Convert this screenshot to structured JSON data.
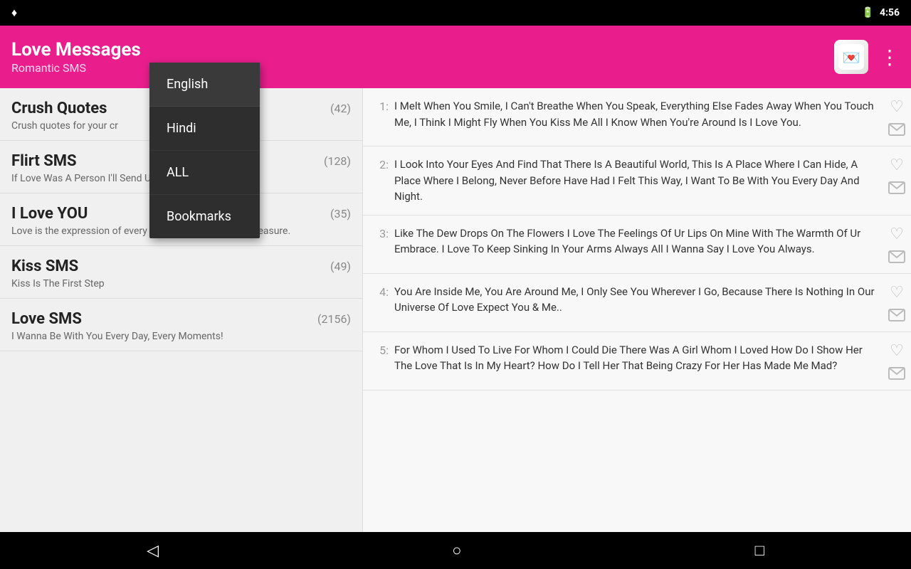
{
  "statusBar": {
    "leftIcon": "♦",
    "time": "4:56",
    "batteryIcon": "🔋"
  },
  "appBar": {
    "title": "Love Messages",
    "subtitle": "Romantic SMS",
    "moreIcon": "⋮"
  },
  "dropdown": {
    "items": [
      {
        "label": "English",
        "id": "english"
      },
      {
        "label": "Hindi",
        "id": "hindi"
      },
      {
        "label": "ALL",
        "id": "all"
      },
      {
        "label": "Bookmarks",
        "id": "bookmarks"
      }
    ]
  },
  "categories": [
    {
      "name": "Crush Quotes",
      "count": "(42)",
      "desc": "Crush quotes for your cr"
    },
    {
      "name": "Flirt SMS",
      "count": "(128)",
      "desc": "If Love Was A Person I'll Send U \"Me\""
    },
    {
      "name": "I Love YOU",
      "count": "(35)",
      "desc": "Love is the expression of every emotion that once can treasure."
    },
    {
      "name": "Kiss SMS",
      "count": "(49)",
      "desc": "Kiss Is The First Step"
    },
    {
      "name": "Love SMS",
      "count": "(2156)",
      "desc": "I Wanna Be With You Every Day, Every Moments!"
    }
  ],
  "messages": [
    {
      "number": "1:",
      "text": " I Melt When You Smile, I Can't Breathe When You Speak, Everything Else Fades Away When You Touch Me, I Think I Might Fly When You Kiss Me All I Know When You're Around Is I Love You."
    },
    {
      "number": "2:",
      "text": " I Look Into Your Eyes And Find That There Is A Beautiful World, This Is A Place Where I Can Hide, A Place Where I Belong, Never Before Have Had I Felt This Way, I Want To Be With You Every Day And Night."
    },
    {
      "number": "3:",
      "text": " Like The Dew Drops On The Flowers I Love The Feelings Of Ur Lips On Mine With The Warmth Of Ur Embrace. I Love To Keep Sinking In Your Arms Always All I Wanna Say I Love You Always."
    },
    {
      "number": "4:",
      "text": " You Are Inside Me, You Are Around Me, I Only See You Wherever I Go, Because There Is Nothing In Our Universe Of Love Expect You & Me.."
    },
    {
      "number": "5:",
      "text": " For Whom I Used To Live For Whom I Could Die There Was A Girl Whom I Loved How Do I Show Her The Love That Is In My Heart? How Do I Tell Her That Being Crazy For Her Has Made Me Mad?"
    }
  ],
  "navBar": {
    "backLabel": "◁",
    "homeLabel": "○",
    "recentLabel": "□"
  }
}
